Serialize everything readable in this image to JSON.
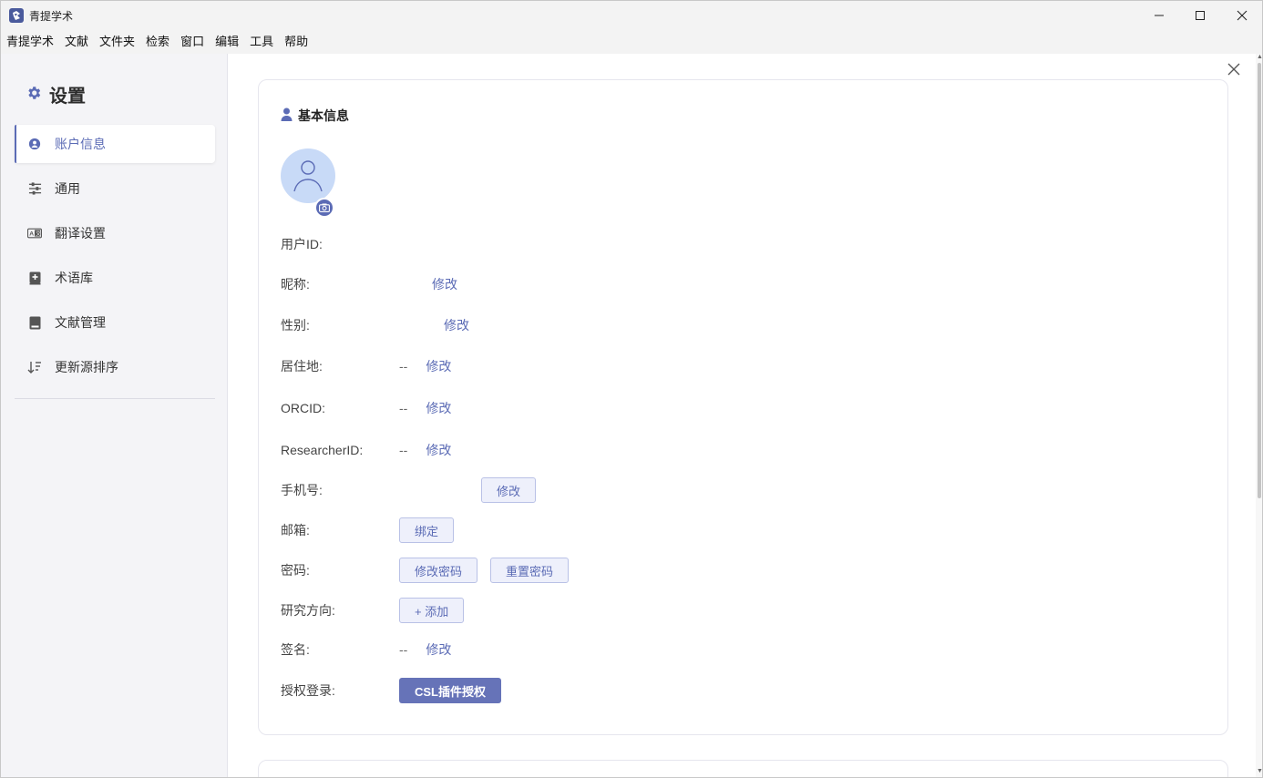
{
  "window": {
    "title": "青提学术"
  },
  "menu": [
    "青提学术",
    "文献",
    "文件夹",
    "检索",
    "窗口",
    "编辑",
    "工具",
    "帮助"
  ],
  "sidebar": {
    "title": "设置",
    "items": [
      {
        "label": "账户信息",
        "icon": "user-circle-icon",
        "active": true
      },
      {
        "label": "通用",
        "icon": "sliders-icon",
        "active": false
      },
      {
        "label": "翻译设置",
        "icon": "translate-icon",
        "active": false
      },
      {
        "label": "术语库",
        "icon": "glossary-icon",
        "active": false
      },
      {
        "label": "文献管理",
        "icon": "book-icon",
        "active": false
      },
      {
        "label": "更新源排序",
        "icon": "sort-icon",
        "active": false
      }
    ]
  },
  "card": {
    "title": "基本信息",
    "fields": {
      "user_id": {
        "label": "用户ID:"
      },
      "nickname": {
        "label": "昵称:",
        "action": "修改"
      },
      "gender": {
        "label": "性别:",
        "action": "修改"
      },
      "residence": {
        "label": "居住地:",
        "value": "--",
        "action": "修改"
      },
      "orcid": {
        "label": "ORCID:",
        "value": "--",
        "action": "修改"
      },
      "researcher_id": {
        "label": "ResearcherID:",
        "value": "--",
        "action": "修改"
      },
      "phone": {
        "label": "手机号:",
        "action": "修改"
      },
      "email": {
        "label": "邮箱:",
        "action": "绑定"
      },
      "password": {
        "label": "密码:",
        "change": "修改密码",
        "reset": "重置密码"
      },
      "research": {
        "label": "研究方向:",
        "action": "+ 添加"
      },
      "signature": {
        "label": "签名:",
        "value": "--",
        "action": "修改"
      },
      "auth": {
        "label": "授权登录:",
        "action": "CSL插件授权"
      }
    }
  },
  "colors": {
    "accent": "#5b6bb5",
    "primary_button": "#6673b8",
    "avatar_bg": "#c8daf7",
    "sidebar_bg": "#f4f4f7"
  }
}
